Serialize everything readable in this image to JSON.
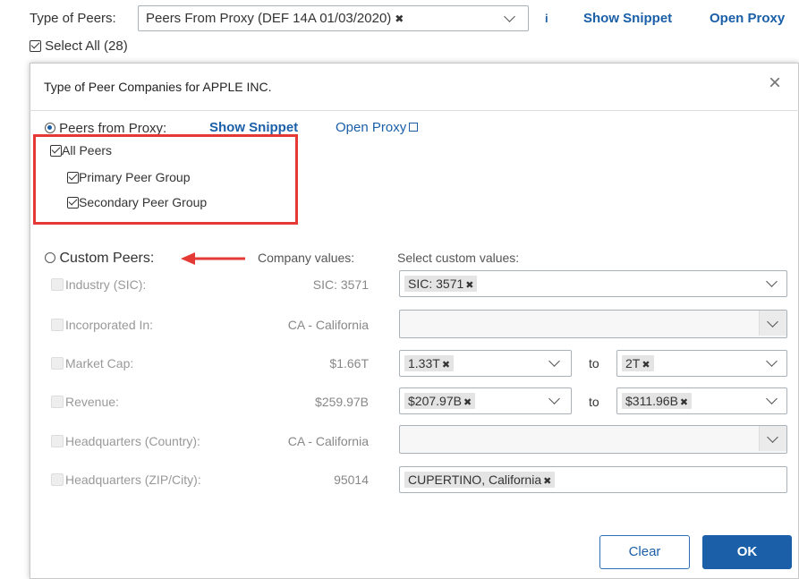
{
  "toolbar": {
    "type_label": "Type of Peers:",
    "select_value": "Peers From Proxy (DEF 14A 01/03/2020)",
    "info_icon": "i",
    "show_snippet": "Show Snippet",
    "open_proxy": "Open Proxy",
    "select_all": "Select All (28)"
  },
  "dialog": {
    "title": "Type of Peer Companies for APPLE INC.",
    "close_icon": "×",
    "proxy": {
      "radio_label": "Peers from Proxy:",
      "show_snippet": "Show Snippet",
      "open_proxy": "Open Proxy",
      "all_peers": "All Peers",
      "primary": "Primary Peer Group",
      "secondary": "Secondary Peer Group"
    },
    "custom": {
      "radio_label": "Custom Peers:",
      "company_values_header": "Company values:",
      "custom_values_header": "Select custom values:",
      "to_label": "to",
      "rows": [
        {
          "label": "Industry (SIC):",
          "value": "SIC: 3571",
          "chip": "SIC: 3571"
        },
        {
          "label": "Incorporated In:",
          "value": "CA - California"
        },
        {
          "label": "Market Cap:",
          "value": "$1.66T",
          "chip_from": "1.33T",
          "chip_to": "2T"
        },
        {
          "label": "Revenue:",
          "value": "$259.97B",
          "chip_from": "$207.97B",
          "chip_to": "$311.96B"
        },
        {
          "label": "Headquarters (Country):",
          "value": "CA - California"
        },
        {
          "label": "Headquarters (ZIP/City):",
          "value": "95014",
          "chip": "CUPERTINO, California"
        }
      ]
    },
    "buttons": {
      "clear": "Clear",
      "ok": "OK"
    }
  },
  "colors": {
    "link": "#1a5fa8",
    "highlight_box": "#e53935",
    "arrow": "#e53935",
    "ok_button": "#1a5fa8"
  }
}
